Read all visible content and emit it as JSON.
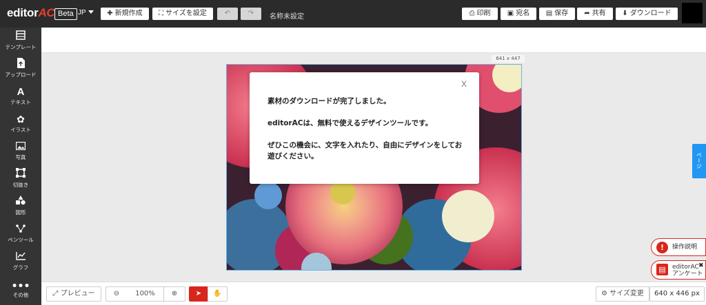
{
  "app": {
    "logo_main": "editor",
    "logo_accent": "AC",
    "beta": "Beta",
    "lang": "JP"
  },
  "toolbar": {
    "new_label": "新規作成",
    "size_label": "サイズを設定",
    "doc_name": "名称未設定",
    "print_label": "印刷",
    "address_label": "宛名",
    "save_label": "保存",
    "share_label": "共有",
    "download_label": "ダウンロード"
  },
  "sidebar": {
    "items": [
      {
        "label": "テンプレート",
        "icon": "template-icon"
      },
      {
        "label": "アップロード",
        "icon": "upload-icon"
      },
      {
        "label": "テキスト",
        "icon": "text-icon"
      },
      {
        "label": "イラスト",
        "icon": "illust-icon"
      },
      {
        "label": "写真",
        "icon": "photo-icon"
      },
      {
        "label": "切抜き",
        "icon": "crop-icon"
      },
      {
        "label": "図形",
        "icon": "shapes-icon"
      },
      {
        "label": "ペンツール",
        "icon": "pen-icon"
      },
      {
        "label": "グラフ",
        "icon": "graph-icon"
      },
      {
        "label": "その他",
        "icon": "more-icon"
      }
    ]
  },
  "canvas": {
    "size_label": "641 x 447"
  },
  "modal": {
    "close": "X",
    "line1": "素材のダウンロードが完了しました。",
    "line2": "editorACは、無料で使えるデザインツールです。",
    "line3": "ぜひこの機会に、文字を入れたり、自由にデザインをしてお遊びください。"
  },
  "bottom": {
    "preview_label": "プレビュー",
    "zoom_value": "100%",
    "resize_label": "サイズ変更",
    "size_px": "640 x 446 px"
  },
  "right": {
    "page_tab": "ページ",
    "help_label": "操作説明",
    "survey_line1": "editorAC",
    "survey_line2": "アンケート",
    "survey_close": "✖"
  },
  "colors": {
    "accent": "#d9261c",
    "topbar": "#2b2b2b",
    "sidebar": "#343434",
    "canvas_border": "#6ab3e6",
    "page_tab": "#2196f3"
  }
}
